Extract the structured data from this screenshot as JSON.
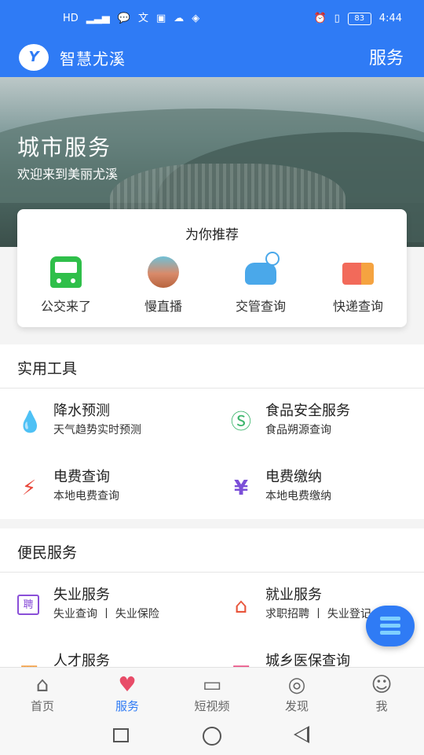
{
  "status_bar": {
    "left_icons": [
      "HD",
      "4G",
      "signal-icon",
      "chat-icon",
      "translate-icon",
      "bag-icon",
      "cloud-download-icon",
      "location-icon"
    ],
    "network_label": "HD",
    "time": "4:44",
    "battery": "83"
  },
  "app_bar": {
    "logo_text": "Y",
    "title": "智慧尤溪",
    "action": "服务"
  },
  "hero": {
    "title": "城市服务",
    "subtitle": "欢迎来到美丽尤溪"
  },
  "recommend": {
    "title": "为你推荐",
    "items": [
      {
        "label": "公交来了",
        "icon": "bus-icon"
      },
      {
        "label": "慢直播",
        "icon": "live-icon"
      },
      {
        "label": "交管查询",
        "icon": "traffic-icon"
      },
      {
        "label": "快递查询",
        "icon": "express-truck-icon"
      }
    ]
  },
  "tools": {
    "title": "实用工具",
    "items": [
      {
        "title": "降水预测",
        "subtitle": "天气趋势实时预测",
        "icon": "rain-drop-icon",
        "glyph": "💧"
      },
      {
        "title": "食品安全服务",
        "subtitle": "食品朔源查询",
        "icon": "food-safety-icon",
        "glyph": "Ⓢ"
      },
      {
        "title": "电费查询",
        "subtitle": "本地电费查询",
        "icon": "lightning-icon",
        "glyph": "⚡"
      },
      {
        "title": "电费缴纳",
        "subtitle": "本地电费缴纳",
        "icon": "payment-hand-icon",
        "glyph": "¥"
      }
    ]
  },
  "services": {
    "title": "便民服务",
    "items": [
      {
        "title": "失业服务",
        "subtitle": "失业查询 丨 失业保险",
        "icon": "resume-icon",
        "glyph": "聘"
      },
      {
        "title": "就业服务",
        "subtitle": "求职招聘 丨 失业登记",
        "icon": "job-house-icon",
        "glyph": "⌂"
      },
      {
        "title": "人才服务",
        "subtitle": "",
        "icon": "talent-icon",
        "glyph": "▦"
      },
      {
        "title": "城乡医保查询",
        "subtitle": "",
        "icon": "medical-insurance-icon",
        "glyph": "▤"
      }
    ]
  },
  "tabbar": {
    "items": [
      {
        "label": "首页",
        "icon": "home-icon",
        "glyph": "⌂"
      },
      {
        "label": "服务",
        "icon": "heart-icon",
        "glyph": "♥",
        "active": true
      },
      {
        "label": "短视频",
        "icon": "video-camera-icon",
        "glyph": "▭"
      },
      {
        "label": "发现",
        "icon": "discover-leaf-icon",
        "glyph": "◎"
      },
      {
        "label": "我",
        "icon": "profile-icon",
        "glyph": "☺"
      }
    ]
  },
  "colors": {
    "primary": "#2f7bf5",
    "active_icon": "#e84c68",
    "background": "#f4f4f4"
  }
}
